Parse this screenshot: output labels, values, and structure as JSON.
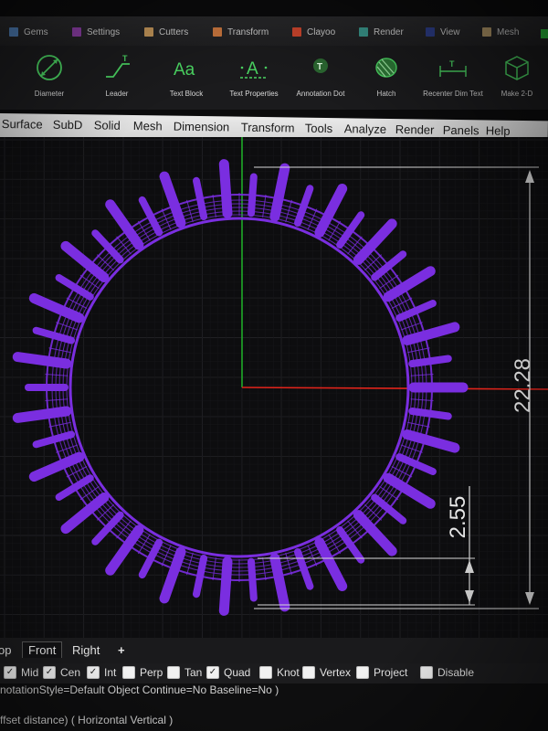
{
  "tabs": [
    {
      "label": "Gems",
      "color": "#4f7fb8"
    },
    {
      "label": "Settings",
      "color": "#8e3fa8"
    },
    {
      "label": "Cutters",
      "color": "#c99a5c"
    },
    {
      "label": "Transform",
      "color": "#d07a40"
    },
    {
      "label": "Clayoo",
      "color": "#d2472e"
    },
    {
      "label": "Render",
      "color": "#3b9a8f"
    },
    {
      "label": "View",
      "color": "#2e3f8c"
    },
    {
      "label": "Mesh",
      "color": "#b59a6a"
    }
  ],
  "tools": [
    {
      "label": "Diameter",
      "icon": "diameter-icon"
    },
    {
      "label": "Leader",
      "icon": "leader-icon"
    },
    {
      "label": "Text Block",
      "icon": "text-block-icon"
    },
    {
      "label": "Text Properties",
      "icon": "text-properties-icon"
    },
    {
      "label": "Annotation Dot",
      "icon": "annotation-dot-icon"
    },
    {
      "label": "Hatch",
      "icon": "hatch-icon"
    },
    {
      "label": "Recenter Dim Text",
      "icon": "recenter-dim-text-icon"
    },
    {
      "label": "Make 2-D",
      "icon": "make-2d-icon"
    }
  ],
  "menu": [
    "Surface",
    "SubD",
    "Solid",
    "Mesh",
    "Dimension",
    "Transform",
    "Tools",
    "Analyze",
    "Render",
    "Panels",
    "Help"
  ],
  "viewport": {
    "dimension_outer": "22.28",
    "dimension_inner": "2.55",
    "object_color": "#7a2ee0",
    "x_axis_color": "#e0241b",
    "y_axis_color": "#1fbf2a"
  },
  "view_tabs": {
    "partial": "op",
    "front": "Front",
    "right": "Right",
    "add": "+"
  },
  "osnaps": [
    {
      "label": "Mid",
      "checked": true
    },
    {
      "label": "Cen",
      "checked": true
    },
    {
      "label": "Int",
      "checked": true
    },
    {
      "label": "Perp",
      "checked": false
    },
    {
      "label": "Tan",
      "checked": false
    },
    {
      "label": "Quad",
      "checked": true
    },
    {
      "label": "Knot",
      "checked": false
    },
    {
      "label": "Vertex",
      "checked": false
    },
    {
      "label": "Project",
      "checked": false
    },
    {
      "label": "Disable",
      "checked": false
    }
  ],
  "command": {
    "line1": "notationStyle=Default  Object  Continue=No  Baseline=No )",
    "line2": "ffset distance) ( Horizontal  Vertical )"
  }
}
